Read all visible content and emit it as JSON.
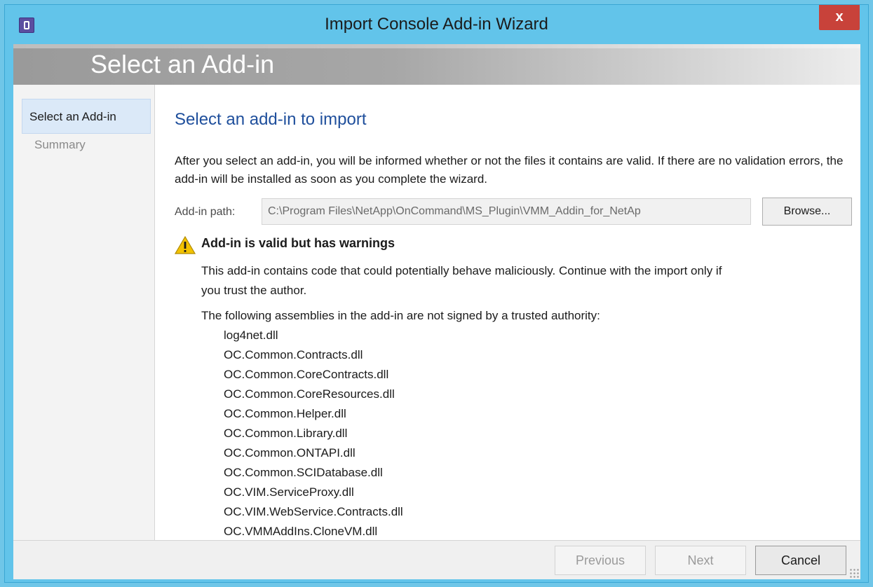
{
  "window": {
    "title": "Import Console Add-in Wizard",
    "close_label": "x"
  },
  "banner": {
    "title": "Select an Add-in"
  },
  "sidebar": {
    "steps": [
      {
        "label": "Select an Add-in",
        "active": true
      },
      {
        "label": "Summary",
        "active": false
      }
    ]
  },
  "main": {
    "heading": "Select an add-in to import",
    "description": "After you select an add-in, you will be informed whether or not the files it contains are valid. If there are no validation errors, the add-in will be installed as soon as you complete the wizard.",
    "path_label": "Add-in path:",
    "path_value": "C:\\Program Files\\NetApp\\OnCommand\\MS_Plugin\\VMM_Addin_for_NetAp",
    "browse_label": "Browse...",
    "warning": {
      "title": "Add-in is valid but has warnings",
      "description_line1": "This add-in contains code that could potentially behave maliciously. Continue with the import only if",
      "description_line2": "you trust the author.",
      "unsigned_heading": "The following assemblies in the add-in are not signed by a trusted authority:",
      "assemblies": [
        "log4net.dll",
        "OC.Common.Contracts.dll",
        "OC.Common.CoreContracts.dll",
        "OC.Common.CoreResources.dll",
        "OC.Common.Helper.dll",
        "OC.Common.Library.dll",
        "OC.Common.ONTAPI.dll",
        "OC.Common.SCIDatabase.dll",
        "OC.VIM.ServiceProxy.dll",
        "OC.VIM.WebService.Contracts.dll",
        "OC.VMMAddIns.CloneVM.dll"
      ]
    }
  },
  "footer": {
    "previous_label": "Previous",
    "next_label": "Next",
    "cancel_label": "Cancel"
  },
  "colors": {
    "window_frame": "#62c4ea",
    "close_button": "#c8423a",
    "heading_blue": "#1f4f9c",
    "active_step_bg": "#dbe9f8",
    "warning_yellow": "#f2c200"
  }
}
